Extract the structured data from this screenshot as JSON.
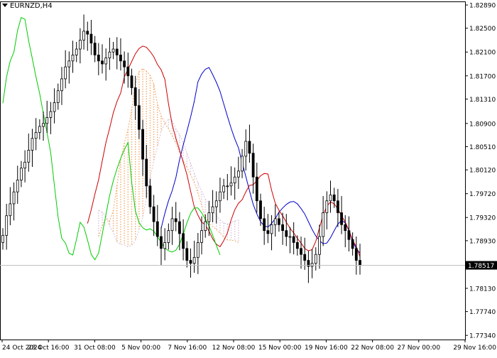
{
  "header": {
    "symbol_timeframe": "EURNZD,H4"
  },
  "colors": {
    "background": "#ffffff",
    "frame": "#000000",
    "candle": "#000000",
    "tenkan": "#cc0000",
    "kijun": "#0000cc",
    "chikou": "#00cc00",
    "senkou_a": "#f4a460",
    "senkou_b": "#d8bfd8",
    "price_line": "#c0c0c0"
  },
  "chart_data": {
    "type": "candlestick",
    "indicator": "Ichimoku Kinko Hyo",
    "symbol": "EURNZD",
    "timeframe": "H4",
    "ylim": [
      1.7727,
      1.8295
    ],
    "y_ticks": [
      "1.82890",
      "1.82500",
      "1.82100",
      "1.81700",
      "1.81310",
      "1.80900",
      "1.80510",
      "1.80120",
      "1.79720",
      "1.79320",
      "1.78930",
      "1.78517",
      "1.78130",
      "1.77740",
      "1.77340"
    ],
    "current_price": "1.78517",
    "x_ticks": [
      "24 Oct 2024",
      "28 Oct 16:00",
      "31 Oct 08:00",
      "5 Nov 00:00",
      "7 Nov 16:00",
      "12 Nov 08:00",
      "15 Nov 00:00",
      "19 Nov 16:00",
      "22 Nov 08:00",
      "27 Nov 00:00",
      "29 Nov 16:00"
    ],
    "candles_close": [
      1.7902,
      1.7935,
      1.7955,
      1.7975,
      1.7995,
      1.8015,
      1.8025,
      1.8045,
      1.8065,
      1.8075,
      1.8085,
      1.809,
      1.81,
      1.811,
      1.8125,
      1.8145,
      1.8165,
      1.8185,
      1.8195,
      1.8205,
      1.8215,
      1.823,
      1.8245,
      1.824,
      1.8225,
      1.8205,
      1.8195,
      1.819,
      1.82,
      1.821,
      1.8215,
      1.8205,
      1.8195,
      1.8185,
      1.817,
      1.815,
      1.812,
      1.808,
      1.803,
      1.7985,
      1.795,
      1.7925,
      1.79,
      1.788,
      1.789,
      1.791,
      1.793,
      1.7925,
      1.7905,
      1.788,
      1.786,
      1.7855,
      1.7865,
      1.789,
      1.791,
      1.7925,
      1.794,
      1.795,
      1.796,
      1.7975,
      1.7985,
      1.7985,
      1.799,
      1.8,
      1.801,
      1.8035,
      1.806,
      1.804,
      1.8,
      1.796,
      1.793,
      1.791,
      1.7905,
      1.792,
      1.793,
      1.792,
      1.791,
      1.79,
      1.79,
      1.789,
      1.788,
      1.787,
      1.786,
      1.785,
      1.7855,
      1.787,
      1.79,
      1.794,
      1.796,
      1.797,
      1.796,
      1.794,
      1.792,
      1.791,
      1.7895,
      1.788,
      1.786,
      1.7852
    ],
    "tenkan_sen": [
      1.7922,
      1.7945,
      1.7971,
      1.7995,
      1.8027,
      1.8058,
      1.8082,
      1.8108,
      1.8127,
      1.8141,
      1.8168,
      1.8181,
      1.8194,
      1.8207,
      1.8216,
      1.822,
      1.8218,
      1.8211,
      1.8202,
      1.8189,
      1.818,
      1.8164,
      1.8123,
      1.8088,
      1.8065,
      1.8045,
      1.8025,
      1.8004,
      1.7976,
      1.795,
      1.7936,
      1.7924,
      1.792,
      1.7909,
      1.7896,
      1.7887,
      1.7883,
      1.7893,
      1.7906,
      1.7928,
      1.7945,
      1.7956,
      1.7962,
      1.7975,
      1.7986,
      1.7987,
      1.7994,
      1.8002,
      1.8006,
      1.8005,
      1.7978,
      1.7956,
      1.7944,
      1.7935,
      1.7924,
      1.7914,
      1.7906,
      1.7897,
      1.7889,
      1.788,
      1.7876,
      1.7878,
      1.7892,
      1.7915,
      1.7936,
      1.7951,
      1.7958,
      1.7955,
      1.7946,
      1.7935,
      1.7924,
      1.7911,
      1.7894,
      1.7883,
      1.7866
    ],
    "kijun_sen": [
      1.7914,
      1.7939,
      1.796,
      1.7977,
      1.7999,
      1.8029,
      1.8054,
      1.8077,
      1.8101,
      1.8127,
      1.816,
      1.8173,
      1.8181,
      1.8184,
      1.8172,
      1.8159,
      1.8144,
      1.8123,
      1.8102,
      1.8082,
      1.8064,
      1.8049,
      1.8024,
      1.8001,
      1.7977,
      1.7954,
      1.7938,
      1.7925,
      1.7918,
      1.7916,
      1.7922,
      1.793,
      1.7941,
      1.7948,
      1.7954,
      1.7958,
      1.7959,
      1.7955,
      1.7947,
      1.7938,
      1.7925,
      1.7912,
      1.7901,
      1.7893,
      1.7888,
      1.7889,
      1.7898,
      1.791,
      1.7921,
      1.7927,
      1.7923,
      1.791,
      1.7892,
      1.788,
      1.7872
    ],
    "chikou_span": [
      1.8124,
      1.8168,
      1.8195,
      1.821,
      1.8246,
      1.8268,
      1.8265,
      1.8229,
      1.8199,
      1.8168,
      1.814,
      1.8107,
      1.8075,
      1.8041,
      1.7986,
      1.7933,
      1.7897,
      1.7889,
      1.7872,
      1.7869,
      1.7895,
      1.7924,
      1.7916,
      1.7894,
      1.787,
      1.7861,
      1.7872,
      1.7904,
      1.7937,
      1.7969,
      1.7994,
      1.8014,
      1.8031,
      1.8046,
      1.8058,
      1.7991,
      1.7943,
      1.7923,
      1.7915,
      1.7911,
      1.7913,
      1.7909,
      1.79,
      1.789,
      1.7881,
      1.7876,
      1.7874,
      1.7877,
      1.7887,
      1.7904,
      1.7923,
      1.7939,
      1.7948,
      1.7948,
      1.794,
      1.7929,
      1.7918,
      1.7902,
      1.7885,
      1.7869
    ],
    "senkou_span_a": [
      1.79,
      1.7918,
      1.793,
      1.7926,
      1.7944,
      1.7986,
      1.803,
      1.8057,
      1.808,
      1.8114,
      1.8156,
      1.8177,
      1.8182,
      1.8178,
      1.8171,
      1.8156,
      1.8122,
      1.8103,
      1.8091,
      1.8081,
      1.8069,
      1.8057,
      1.8041,
      1.8027,
      1.8016,
      1.8004,
      1.7991,
      1.7973,
      1.7952,
      1.7933,
      1.7923,
      1.7917,
      1.7912,
      1.7906,
      1.7899,
      1.7894,
      1.7894,
      1.7893,
      1.789
    ],
    "senkou_span_b": [
      1.7944,
      1.7941,
      1.7934,
      1.7918,
      1.7907,
      1.7891,
      1.7887,
      1.7886,
      1.7883,
      1.7885,
      1.7893,
      1.7912,
      1.7933,
      1.7963,
      1.7998,
      1.8027,
      1.8051,
      1.8077,
      1.809,
      1.8097,
      1.8095,
      1.8081,
      1.8071,
      1.8058,
      1.804,
      1.8023,
      1.8006,
      1.7991,
      1.7976,
      1.7963,
      1.7954,
      1.7943,
      1.7935,
      1.7928,
      1.7923,
      1.7921,
      1.7924,
      1.7926,
      1.7928
    ]
  }
}
